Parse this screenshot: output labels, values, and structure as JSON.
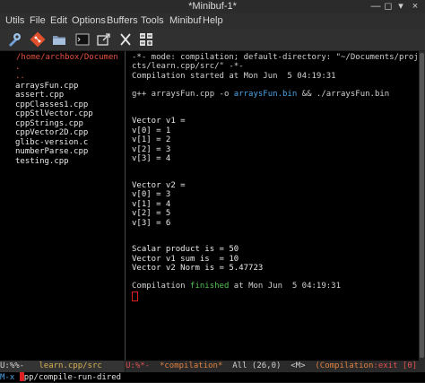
{
  "window": {
    "title": "*Minibuf-1*",
    "controls": [
      "×",
      "▾",
      "◻",
      "—"
    ]
  },
  "menu": [
    "Utils",
    "File",
    "Edit",
    "Options",
    "Buffers",
    "Tools",
    "Minibuf",
    "Help"
  ],
  "toolbar": {
    "icons": [
      "tools-icon",
      "git-icon",
      "folder-icon",
      "terminal-icon",
      "export-icon",
      "cut-icon",
      "calculator-icon"
    ]
  },
  "dired": {
    "path": "/home/archbox/Documen",
    "lines": [
      ".",
      "..",
      "arraysFun.cpp",
      "assert.cpp",
      "cppClasses1.cpp",
      "cppStlVector.cpp",
      "cppStrings.cpp",
      "cppVector2D.cpp",
      "glibc-version.c",
      "numberParse.cpp",
      "testing.cpp"
    ]
  },
  "compilation": {
    "header1": "-*- mode: compilation; default-directory: \"~/Documents/proje",
    "header2": "cts/learn.cpp/src/\" -*-",
    "started": "Compilation started at Mon Jun  5 04:19:31",
    "cmd_pre": "g++ arraysFun.cpp -o ",
    "cmd_bin1": "arraysFun.bin",
    "cmd_mid": " && ./arraysFun.bin",
    "v1_title": "Vector v1 =",
    "v1": [
      "v[0] = 1",
      "v[1] = 2",
      "v[2] = 3",
      "v[3] = 4"
    ],
    "v2_title": "Vector v2 =",
    "v2": [
      "v[0] = 3",
      "v[1] = 4",
      "v[2] = 5",
      "v[3] = 6"
    ],
    "scalar": "Scalar product is = 50",
    "sum": "Vector v1 sum is  = 10",
    "norm": "Vector v2 Norm is = 5.47723",
    "finished_pre": "Compilation ",
    "finished_word": "finished",
    "finished_post": " at Mon Jun  5 04:19:31"
  },
  "modeline_left": {
    "flags": "U:%%-",
    "buffer": "learn.cpp/src"
  },
  "modeline_right": {
    "flags": "U:%*-",
    "buffer": "*compilation*",
    "pos": "All (26,0)",
    "mode_tag": "<M>",
    "mode_pre": "(Compilation",
    "mode_status": ":exit",
    "mode_post": " [0]"
  },
  "minibuffer": {
    "prompt": "M-x ",
    "input": "pp/compile-run-dired"
  }
}
